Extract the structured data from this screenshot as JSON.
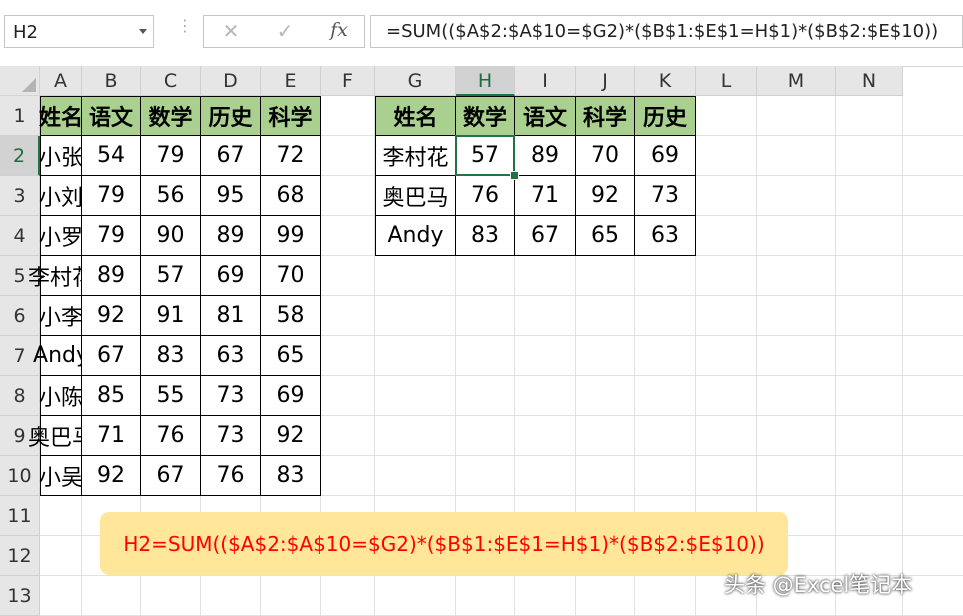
{
  "formula_bar": {
    "name_box": "H2",
    "formula": "=SUM(($A$2:$A$10=$G2)*($B$1:$E$1=H$1)*($B$2:$E$10))",
    "icons": [
      "cancel-icon",
      "enter-icon",
      "function-icon"
    ],
    "fx_label": "fx"
  },
  "sheet": {
    "columns": [
      "A",
      "B",
      "C",
      "D",
      "E",
      "F",
      "G",
      "H",
      "I",
      "J",
      "K",
      "L",
      "M",
      "N"
    ],
    "rows": [
      "1",
      "2",
      "3",
      "4",
      "5",
      "6",
      "7",
      "8",
      "9",
      "10",
      "11",
      "12",
      "13"
    ],
    "selected_column": "H",
    "selected_row": "2",
    "header_fill": "#a9d08e"
  },
  "source_table": {
    "headers": [
      "姓名",
      "语文",
      "数学",
      "历史",
      "科学"
    ],
    "rows": [
      [
        "小张",
        "54",
        "79",
        "67",
        "72"
      ],
      [
        "小刘",
        "79",
        "56",
        "95",
        "68"
      ],
      [
        "小罗",
        "79",
        "90",
        "89",
        "99"
      ],
      [
        "李村花",
        "89",
        "57",
        "69",
        "70"
      ],
      [
        "小李",
        "92",
        "91",
        "81",
        "58"
      ],
      [
        "Andy",
        "67",
        "83",
        "63",
        "65"
      ],
      [
        "小陈",
        "85",
        "55",
        "73",
        "69"
      ],
      [
        "奥巴马",
        "71",
        "76",
        "73",
        "92"
      ],
      [
        "小吴",
        "92",
        "67",
        "76",
        "83"
      ]
    ]
  },
  "lookup_table": {
    "headers": [
      "姓名",
      "数学",
      "语文",
      "科学",
      "历史"
    ],
    "rows": [
      [
        "李村花",
        "57",
        "89",
        "70",
        "69"
      ],
      [
        "奥巴马",
        "76",
        "71",
        "92",
        "73"
      ],
      [
        "Andy",
        "83",
        "67",
        "65",
        "63"
      ]
    ]
  },
  "note": {
    "text": "H2=SUM(($A$2:$A$10=$G2)*($B$1:$E$1=H$1)*($B$2:$E$10))",
    "color": "#ff0000",
    "background": "#ffe699"
  },
  "watermark": "头条 @Excel笔记本"
}
